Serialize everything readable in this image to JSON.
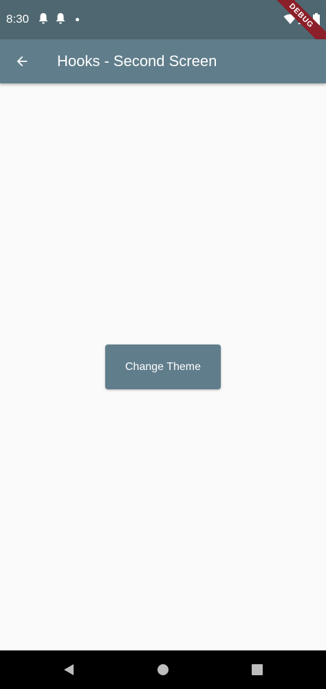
{
  "status_bar": {
    "time": "8:30",
    "icons": [
      "notification-bell-icon",
      "notification-bell-icon",
      "dot-icon",
      "wifi-icon",
      "signal-icon",
      "battery-icon"
    ],
    "debug_banner": "DEBUG",
    "colors": {
      "background": "#4f6770",
      "ribbon": "#8b1f2a"
    }
  },
  "app_bar": {
    "title": "Hooks - Second Screen",
    "back_icon": "arrow-back-icon",
    "color": "#607d8b"
  },
  "main": {
    "button_label": "Change Theme",
    "button_color": "#607d8b",
    "background": "#fafafa"
  },
  "nav_bar": {
    "icons": [
      "back-triangle-icon",
      "home-circle-icon",
      "recents-square-icon"
    ]
  }
}
